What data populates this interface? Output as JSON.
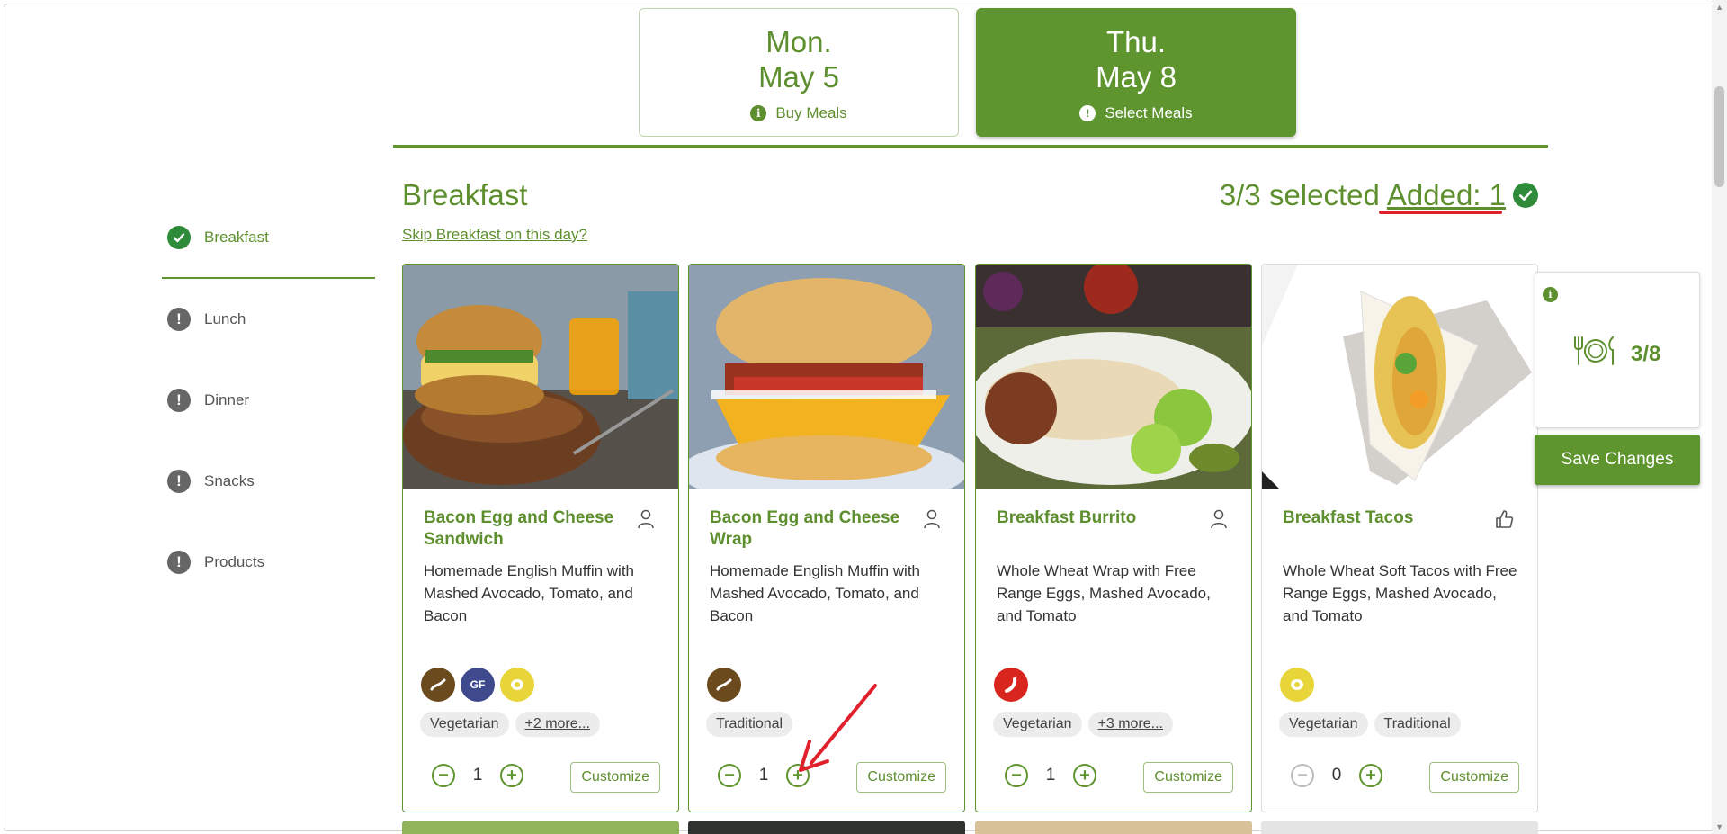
{
  "days": [
    {
      "dow": "Mon.",
      "date": "May 5",
      "status": "Buy Meals",
      "active": false
    },
    {
      "dow": "Thu.",
      "date": "May 8",
      "status": "Select Meals",
      "active": true
    }
  ],
  "sidebar": {
    "items": [
      {
        "label": "Breakfast",
        "state": "complete"
      },
      {
        "label": "Lunch",
        "state": "warning"
      },
      {
        "label": "Dinner",
        "state": "warning"
      },
      {
        "label": "Snacks",
        "state": "warning"
      },
      {
        "label": "Products",
        "state": "warning"
      }
    ]
  },
  "section": {
    "title": "Breakfast",
    "skip_link": "Skip Breakfast on this day?",
    "selected": "3/3 selected",
    "added": "Added: 1"
  },
  "cards": [
    {
      "name": "Bacon Egg and Cheese Sandwich",
      "description": "Homemade English Muffin with Mashed Avocado, Tomato, and Bacon",
      "corner_icon": "person-icon",
      "badges": [
        {
          "icon": "bacon-icon",
          "color": "#6b4a1e"
        },
        {
          "label": "GF",
          "icon": "gluten-free-icon",
          "color": "#3f4a8c"
        },
        {
          "icon": "egg-icon",
          "color": "#e8d53a"
        }
      ],
      "tags": [
        "Vegetarian"
      ],
      "more": "+2 more...",
      "qty": "1",
      "customize": "Customize"
    },
    {
      "name": "Bacon Egg and Cheese Wrap",
      "description": "Homemade English Muffin with Mashed Avocado, Tomato, and Bacon",
      "corner_icon": "person-icon",
      "badges": [
        {
          "icon": "bacon-icon",
          "color": "#6b4a1e"
        }
      ],
      "tags": [
        "Traditional"
      ],
      "more": "",
      "qty": "1",
      "customize": "Customize"
    },
    {
      "name": "Breakfast Burrito",
      "description": "Whole Wheat Wrap with Free Range Eggs, Mashed Avocado, and Tomato",
      "corner_icon": "person-icon",
      "badges": [
        {
          "icon": "spicy-icon",
          "color": "#d8261e"
        }
      ],
      "tags": [
        "Vegetarian"
      ],
      "more": "+3 more...",
      "qty": "1",
      "customize": "Customize"
    },
    {
      "name": "Breakfast Tacos",
      "description": "Whole Wheat Soft Tacos with Free Range Eggs, Mashed Avocado, and Tomato",
      "corner_icon": "thumbs-up-icon",
      "badges": [
        {
          "icon": "egg-icon",
          "color": "#e8d53a"
        }
      ],
      "tags": [
        "Vegetarian",
        "Traditional"
      ],
      "more": "",
      "qty": "0",
      "customize": "Customize"
    }
  ],
  "panel": {
    "meal_count": "3/8",
    "save_label": "Save Changes"
  },
  "colors": {
    "accent": "#5e952f",
    "accent_text": "#5e8f2e",
    "annotation": "#e0202c"
  }
}
